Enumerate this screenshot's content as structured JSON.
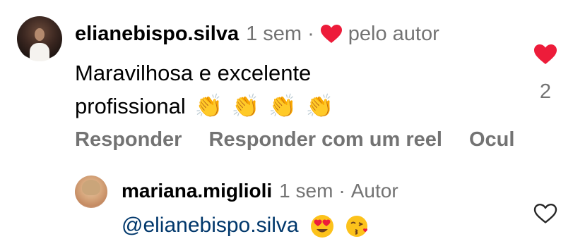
{
  "comment": {
    "username": "elianebispo.silva",
    "time": "1 sem",
    "separator": "·",
    "liked_by_author": "pelo autor",
    "text_line1": "Maravilhosa e excelente",
    "text_line2": "profissional",
    "emoji": [
      "👏",
      "👏",
      "👏",
      "👏"
    ],
    "like_count": "2",
    "actions": {
      "reply": "Responder",
      "reply_reel": "Responder com um reel",
      "hide": "Ocul"
    },
    "heart_color": "#ed1c3a"
  },
  "reply": {
    "username": "mariana.miglioli",
    "time": "1 sem",
    "separator": "·",
    "badge": "Autor",
    "mention": "@elianebispo.silva",
    "emoji": [
      "😍",
      "😘"
    ],
    "mention_color": "#00376b"
  },
  "icons": {
    "small_heart": "filled-heart-icon",
    "like_heart": "filled-heart-icon",
    "reply_like": "heart-outline-icon"
  }
}
